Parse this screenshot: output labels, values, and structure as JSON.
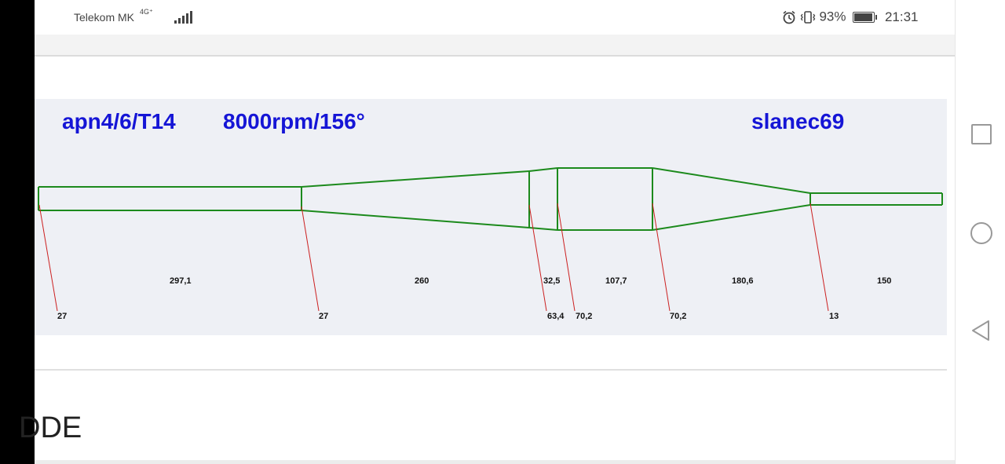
{
  "status_bar": {
    "carrier": "Telekom MK",
    "network": "4G⁺",
    "battery_percent": "93%",
    "battery_level": 0.93,
    "time": "21:31",
    "icons": [
      "signal-icon",
      "alarm-icon",
      "vibrate-icon",
      "battery-icon"
    ]
  },
  "image": {
    "title_left": "apn4/6/T14",
    "title_mid": "8000rpm/156°",
    "title_right": "slanec69",
    "title_color": "#1515d6",
    "line_color": "#1c8a1c",
    "marker_color": "#cc2020",
    "segment_lengths": [
      "297,1",
      "260",
      "32,5",
      "107,7",
      "180,6",
      "150"
    ],
    "diameters": [
      "27",
      "27",
      "63,4",
      "70,2",
      "70,2",
      "13"
    ]
  },
  "page": {
    "bottom_text": "DDE"
  },
  "nav": {
    "icons": [
      "recent-apps-icon",
      "home-icon",
      "back-icon"
    ]
  }
}
